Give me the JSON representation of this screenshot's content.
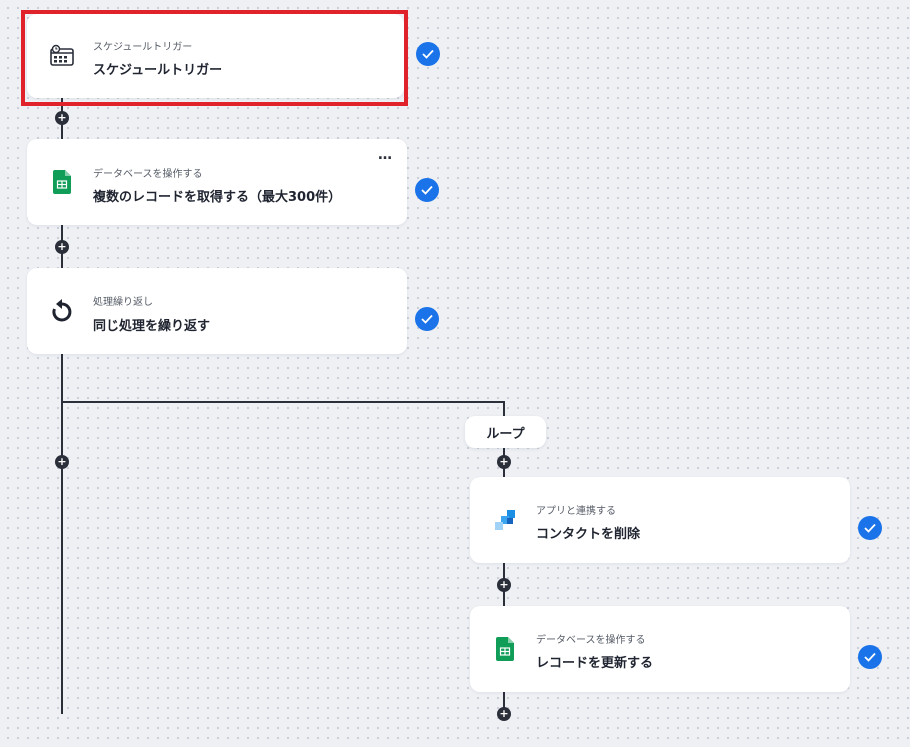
{
  "cards": [
    {
      "subtitle": "スケジュールトリガー",
      "title": "スケジュールトリガー"
    },
    {
      "subtitle": "データベースを操作する",
      "title": "複数のレコードを取得する（最大300件）",
      "menu": "…"
    },
    {
      "subtitle": "処理繰り返し",
      "title": "同じ処理を繰り返す"
    },
    {
      "subtitle": "アプリと連携する",
      "title": "コンタクトを削除"
    },
    {
      "subtitle": "データベースを操作する",
      "title": "レコードを更新する"
    }
  ],
  "loop_label": "ループ",
  "add_symbol": "+",
  "icons": [
    "calendar-clock-icon",
    "google-sheets-icon",
    "loop-arrow-icon",
    "app-squares-icon",
    "google-sheets-icon",
    "checkmark-icon",
    "plus-icon"
  ],
  "colors": {
    "check": "#1a73e8",
    "highlight": "#e0232a",
    "sheets": "#0f9d58",
    "app_blue": "#1a8fe3",
    "line": "#2a2f3a"
  }
}
